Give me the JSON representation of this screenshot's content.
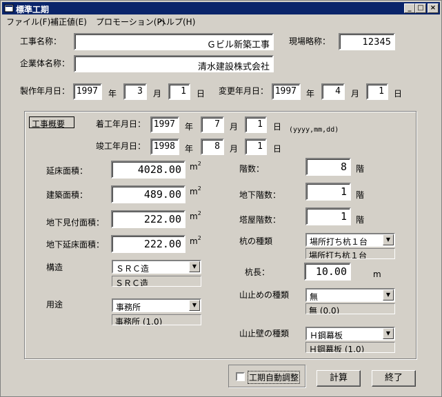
{
  "window": {
    "title": "標準工期",
    "buttons": [
      "_",
      "□",
      "×"
    ]
  },
  "menu": [
    "ファイル(F)",
    "補正値(E)",
    "プロモーション(P)",
    "ヘルプ(H)"
  ],
  "header": {
    "project_name_label": "工事名称：",
    "project_name": "Ｇビル新築工事",
    "site_abbr_label": "現場略称：",
    "site_abbr": "12345",
    "company_label": "企業体名称：",
    "company": "清水建設株式会社",
    "created_label": "製作年月日：",
    "created_year": "1997",
    "created_month": "3",
    "created_day": "1",
    "modified_label": "変更年月日：",
    "modified_year": "1997",
    "modified_month": "4",
    "modified_day": "1",
    "year_unit": "年",
    "month_unit": "月",
    "day_unit": "日"
  },
  "overview": {
    "caption": "工事概要",
    "start_label": "着工年月日：",
    "start_year": "1997",
    "start_month": "7",
    "start_day": "1",
    "date_format_hint": "(yyyy,mm,dd)",
    "end_label": "竣工年月日：",
    "end_year": "1998",
    "end_month": "8",
    "end_day": "1",
    "floor_area_label": "延床面積：",
    "floor_area": "4028.00",
    "building_area_label": "建築面積：",
    "building_area": "489.00",
    "underground_visible_label": "地下見付面積：",
    "underground_visible": "222.00",
    "underground_floor_label": "地下延床面積：",
    "underground_floor": "222.00",
    "area_unit": "m",
    "area_unit_sup": "2",
    "floors_label": "階数：",
    "floors": "8",
    "basement_floors_label": "地下階数：",
    "basement_floors": "1",
    "penthouse_floors_label": "塔屋階数：",
    "penthouse_floors": "1",
    "floor_unit": "階",
    "pile_type_label": "杭の種類",
    "pile_type": "場所打ち杭１台",
    "pile_type_readout": "場所打ち杭１台",
    "pile_length_label": "杭長：",
    "pile_length": "10.00",
    "pile_length_unit": "m",
    "retaining_type_label": "山止めの種類",
    "retaining_type": "無",
    "retaining_type_readout": "無 (0.0)",
    "retaining_wall_label": "山止壁の種類",
    "retaining_wall": "Ｈ鋼幕板",
    "retaining_wall_readout": "Ｈ鋼幕板 (1.0)",
    "structure_label": "構造",
    "structure": "ＳＲＣ造",
    "structure_readout": "ＳＲＣ造",
    "use_label": "用途",
    "use": "事務所",
    "use_readout": "事務所 (1.0)"
  },
  "footer": {
    "auto_adjust_label": "工期自動調整",
    "auto_adjust_checked": false,
    "calc_button": "計算",
    "exit_button": "終了"
  }
}
